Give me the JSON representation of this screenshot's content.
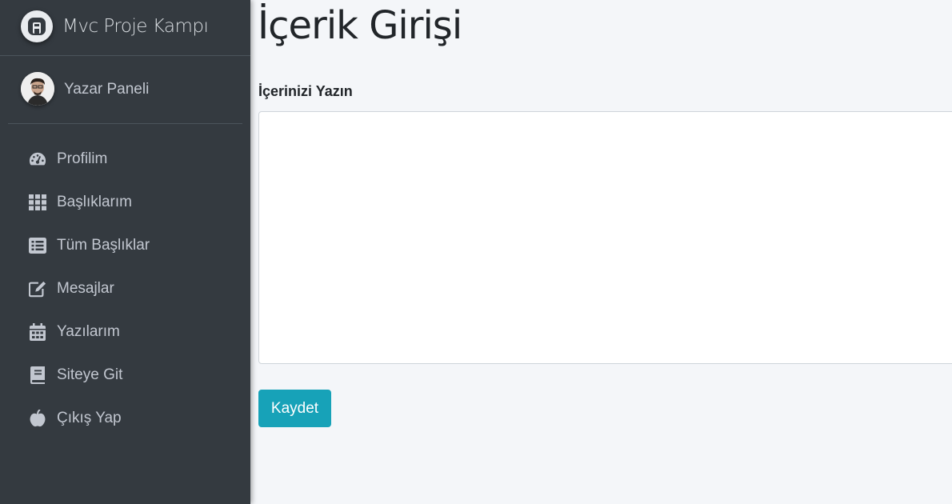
{
  "brand": {
    "title": "Mvc Proje Kampı",
    "logo_icon": "a-logo-icon"
  },
  "user_panel": {
    "name": "Yazar Paneli"
  },
  "nav": {
    "items": [
      {
        "label": "Profilim",
        "icon": "dashboard-gauge-icon"
      },
      {
        "label": "Başlıklarım",
        "icon": "grid-icon"
      },
      {
        "label": "Tüm Başlıklar",
        "icon": "list-icon"
      },
      {
        "label": "Mesajlar",
        "icon": "edit-icon"
      },
      {
        "label": "Yazılarım",
        "icon": "calendar-icon"
      },
      {
        "label": "Siteye Git",
        "icon": "book-icon"
      },
      {
        "label": "Çıkış Yap",
        "icon": "apple-icon"
      }
    ]
  },
  "main": {
    "title": "İçerik Girişi",
    "content_label": "İçerinizi Yazın",
    "content_value": "",
    "save_label": "Kaydet"
  },
  "colors": {
    "sidebar": "#343a40",
    "background": "#f4f6f9",
    "accent": "#17a2b8",
    "nav_text": "#c2c7d0"
  }
}
